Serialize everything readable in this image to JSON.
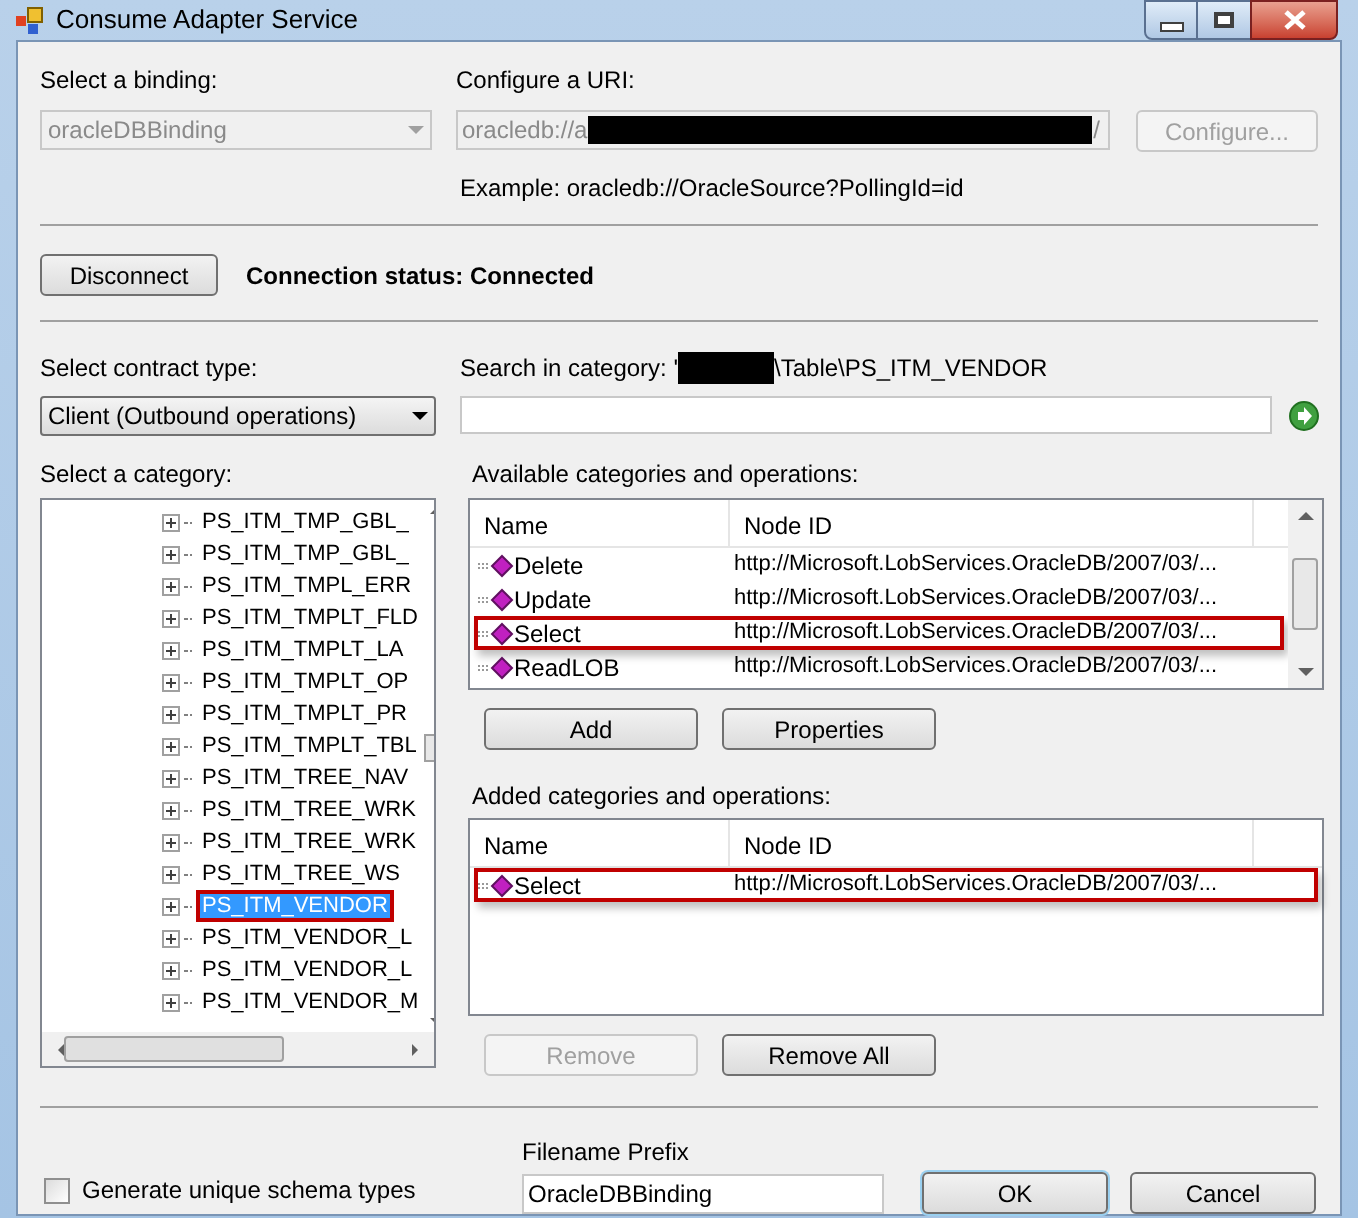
{
  "window": {
    "title": "Consume Adapter Service"
  },
  "binding": {
    "label": "Select a binding:",
    "value": "oracleDBBinding",
    "disabled": true
  },
  "uri": {
    "label": "Configure a URI:",
    "value_start": "oracledb://a",
    "value_end": "/",
    "example": "Example: oracledb://OracleSource?PollingId=id"
  },
  "configure_button": {
    "label": "Configure...",
    "disabled": true
  },
  "disconnect_button": {
    "label": "Disconnect"
  },
  "connection_status": "Connection status: Connected",
  "contract": {
    "label": "Select contract type:",
    "value": "Client (Outbound operations)"
  },
  "search": {
    "label_start": "Search in category: '",
    "label_end": "\\Table\\PS_ITM_VENDOR"
  },
  "category": {
    "label": "Select a category:",
    "items": [
      {
        "label": "PS_ITM_TMP_GBL_",
        "selected": false,
        "highlighted": false
      },
      {
        "label": "PS_ITM_TMP_GBL_",
        "selected": false,
        "highlighted": false
      },
      {
        "label": "PS_ITM_TMPL_ERR",
        "selected": false,
        "highlighted": false
      },
      {
        "label": "PS_ITM_TMPLT_FLD",
        "selected": false,
        "highlighted": false
      },
      {
        "label": "PS_ITM_TMPLT_LA",
        "selected": false,
        "highlighted": false
      },
      {
        "label": "PS_ITM_TMPLT_OP",
        "selected": false,
        "highlighted": false
      },
      {
        "label": "PS_ITM_TMPLT_PR",
        "selected": false,
        "highlighted": false
      },
      {
        "label": "PS_ITM_TMPLT_TBL",
        "selected": false,
        "highlighted": false
      },
      {
        "label": "PS_ITM_TREE_NAV",
        "selected": false,
        "highlighted": false
      },
      {
        "label": "PS_ITM_TREE_WRK",
        "selected": false,
        "highlighted": false
      },
      {
        "label": "PS_ITM_TREE_WRK",
        "selected": false,
        "highlighted": false
      },
      {
        "label": "PS_ITM_TREE_WS",
        "selected": false,
        "highlighted": false
      },
      {
        "label": "PS_ITM_VENDOR",
        "selected": true,
        "highlighted": true
      },
      {
        "label": "PS_ITM_VENDOR_L",
        "selected": false,
        "highlighted": false
      },
      {
        "label": "PS_ITM_VENDOR_L",
        "selected": false,
        "highlighted": false
      },
      {
        "label": "PS_ITM_VENDOR_M",
        "selected": false,
        "highlighted": false
      }
    ]
  },
  "available": {
    "label": "Available categories and operations:",
    "columns": [
      "Name",
      "Node ID"
    ],
    "rows": [
      {
        "name": "Delete",
        "node_id": "http://Microsoft.LobServices.OracleDB/2007/03/...",
        "highlighted": false
      },
      {
        "name": "Update",
        "node_id": "http://Microsoft.LobServices.OracleDB/2007/03/...",
        "highlighted": false
      },
      {
        "name": "Select",
        "node_id": "http://Microsoft.LobServices.OracleDB/2007/03/...",
        "highlighted": true
      },
      {
        "name": "ReadLOB",
        "node_id": "http://Microsoft.LobServices.OracleDB/2007/03/...",
        "highlighted": false
      }
    ]
  },
  "add_button": {
    "label": "Add"
  },
  "properties_button": {
    "label": "Properties"
  },
  "added": {
    "label": "Added categories and operations:",
    "columns": [
      "Name",
      "Node ID"
    ],
    "rows": [
      {
        "name": "Select",
        "node_id": "http://Microsoft.LobServices.OracleDB/2007/03/...",
        "highlighted": true
      }
    ]
  },
  "remove_button": {
    "label": "Remove",
    "disabled": true
  },
  "remove_all_button": {
    "label": "Remove All",
    "disabled": false
  },
  "unique_schema": {
    "label": "Generate unique schema types",
    "checked": false
  },
  "filename_prefix": {
    "label": "Filename Prefix",
    "value": "OracleDBBinding"
  },
  "ok_button": {
    "label": "OK"
  },
  "cancel_button": {
    "label": "Cancel"
  }
}
